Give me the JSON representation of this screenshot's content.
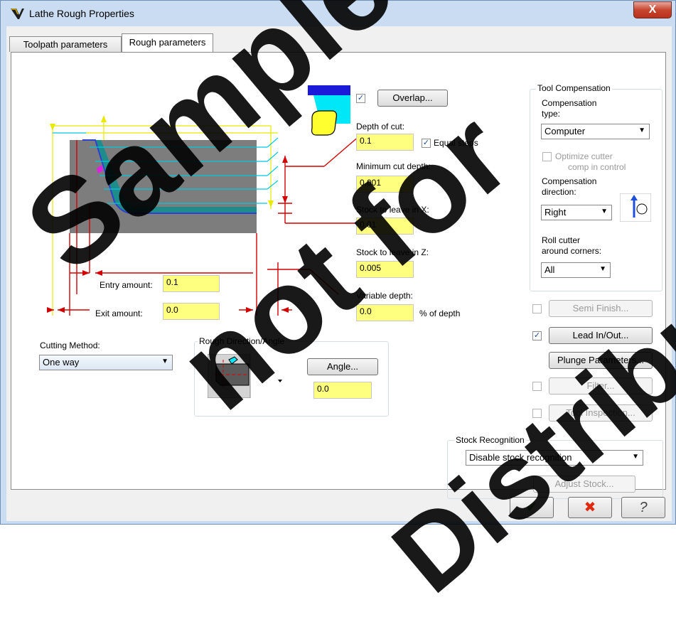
{
  "window": {
    "title": "Lathe Rough Properties",
    "close_label": "X"
  },
  "tabs": [
    {
      "label": "Toolpath parameters"
    },
    {
      "label": "Rough parameters"
    }
  ],
  "overlap": {
    "checked": "✓",
    "button_label": "Overlap..."
  },
  "depth_of_cut": {
    "label": "Depth of cut:",
    "value": "0.1",
    "equal_steps_label": "Equal steps",
    "equal_steps_checked": "✓"
  },
  "minimum_cut_depth": {
    "label": "Minimum cut depth:",
    "value": "0.001"
  },
  "stock_to_leave_x": {
    "label": "Stock to leave in X:",
    "value": "0.01"
  },
  "stock_to_leave_z": {
    "label": "Stock to leave in Z:",
    "value": "0.005"
  },
  "variable_depth": {
    "label": "Variable depth:",
    "value": "0.0",
    "unit": "% of depth"
  },
  "entry_amount": {
    "label": "Entry amount:",
    "value": "0.1"
  },
  "exit_amount": {
    "label": "Exit amount:",
    "value": "0.0"
  },
  "cutting_method": {
    "label": "Cutting Method:",
    "value": "One way"
  },
  "rough_direction": {
    "title": "Rough Direction/Angle",
    "angle_button": "Angle...",
    "angle_value": "0.0"
  },
  "tool_compensation": {
    "title": "Tool Compensation",
    "type_label_1": "Compensation",
    "type_label_2": "type:",
    "type_value": "Computer",
    "optimize_label_1": "Optimize cutter",
    "optimize_label_2": "comp in control",
    "direction_label_1": "Compensation",
    "direction_label_2": "direction:",
    "direction_value": "Right",
    "roll_label_1": "Roll cutter",
    "roll_label_2": "around corners:",
    "roll_value": "All"
  },
  "options": {
    "semi_finish": "Semi Finish...",
    "lead_in_out": "Lead In/Out...",
    "lead_in_out_checked": "✓",
    "plunge_parameters": "Plunge Parameters...",
    "filter": "Filter...",
    "tool_inspection": "Tool Inspection..."
  },
  "stock_recognition": {
    "title": "Stock Recognition",
    "value": "Disable stock recognition",
    "adjust_button": "Adjust Stock..."
  },
  "footer": {
    "ok": "✔",
    "cancel": "✖",
    "help": "?"
  },
  "watermark": {
    "line1": "Sample",
    "line2": "not for",
    "line3": "Distribution"
  },
  "colors": {
    "field": "#ffff7f",
    "accent_cyan": "#00c8e0",
    "accent_red": "#d40000",
    "accent_yellow": "#e8e800",
    "teal_tool": "#00a0a0"
  }
}
